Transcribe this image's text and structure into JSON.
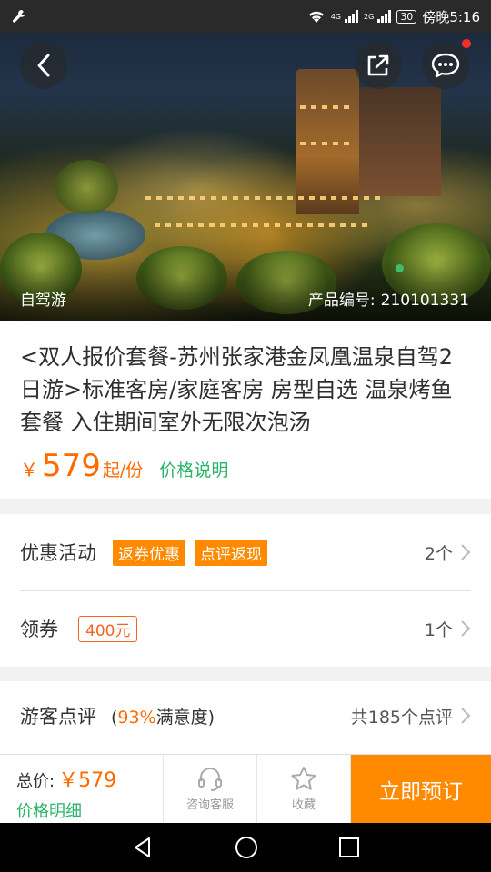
{
  "status_bar": {
    "network_4g": "4G",
    "network_2g": "2G",
    "battery": "30",
    "time": "傍晚5:16"
  },
  "hero": {
    "category": "自驾游",
    "product_code_label": "产品编号:",
    "product_code": "210101331"
  },
  "product": {
    "title": "<双人报价套餐-苏州张家港金凤凰温泉自驾2日游>标准客房/家庭客房 房型自选 温泉烤鱼套餐 入住期间室外无限次泡汤",
    "currency": "￥",
    "price": "579",
    "price_unit": "起/份",
    "price_note": "价格说明"
  },
  "promotions": {
    "label": "优惠活动",
    "tags": [
      "返券优惠",
      "点评返现"
    ],
    "count": "2个"
  },
  "coupons": {
    "label": "领券",
    "amount": "400元",
    "count": "1个"
  },
  "reviews": {
    "label": "游客点评",
    "open_paren": "(",
    "satisfaction_pct": "93%",
    "satisfaction_text": "满意度)",
    "total": "共185个点评"
  },
  "action_bar": {
    "total_label": "总价:",
    "total_amount": "￥579",
    "price_detail": "价格明细",
    "consult": "咨询客服",
    "favorite": "收藏",
    "book_now": "立即预订"
  },
  "colors": {
    "accent_orange": "#ff8a00",
    "price_orange": "#ff6a00",
    "green": "#2bb36a"
  }
}
